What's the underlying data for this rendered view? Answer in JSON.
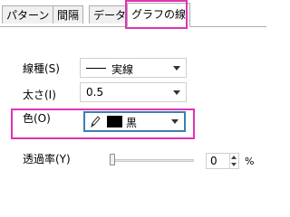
{
  "tabs": [
    {
      "label": "パターン"
    },
    {
      "label": "間隔"
    },
    {
      "label": "データ"
    },
    {
      "label": "グラフの線",
      "active": true
    }
  ],
  "fields": {
    "line_type": {
      "label": "線種(S)",
      "value": "実線"
    },
    "width": {
      "label": "太さ(I)",
      "value": "0.5"
    },
    "color": {
      "label": "色(O)",
      "value": "黒",
      "swatch": "#000000"
    },
    "transparency": {
      "label": "透過率(Y)",
      "value": "0",
      "unit": "%",
      "slider_level": 0
    }
  },
  "colors": {
    "highlight": "#e232b4",
    "focus_border": "#3c7fb1"
  },
  "icons": {
    "color_combo": "pencil-icon"
  }
}
